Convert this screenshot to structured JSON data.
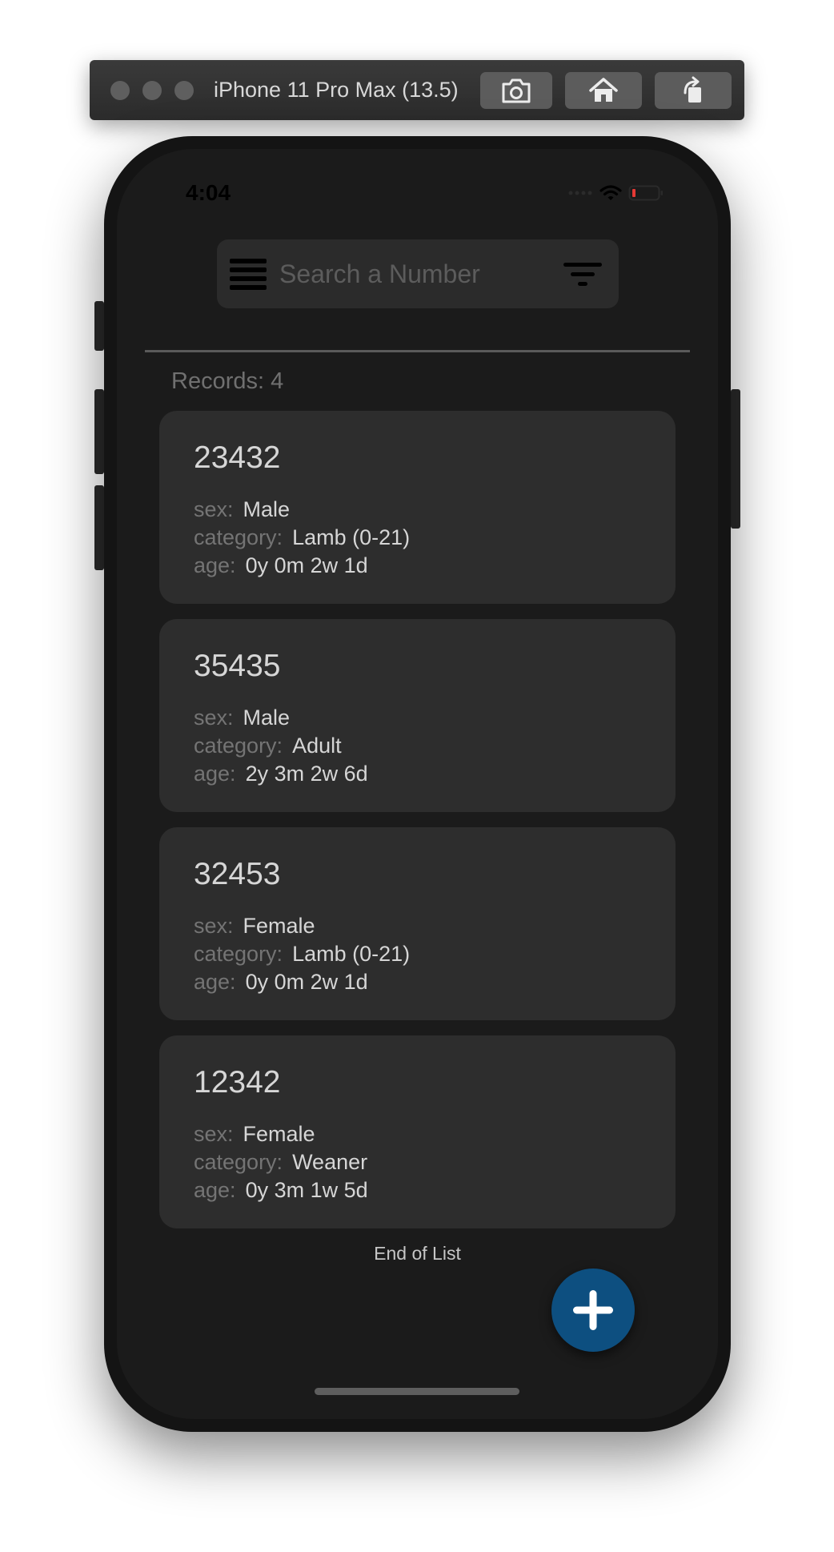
{
  "simulator": {
    "title": "iPhone 11 Pro Max (13.5)",
    "buttons": [
      "screenshot-icon",
      "home-icon",
      "rotate-icon"
    ]
  },
  "status_bar": {
    "time": "4:04",
    "icons": [
      "signal-icon",
      "wifi-icon",
      "battery-low-icon"
    ]
  },
  "search": {
    "placeholder": "Search a Number",
    "value": "",
    "menu_icon": "hamburger-menu-icon",
    "filter_icon": "filter-icon"
  },
  "records": {
    "label": "Records: 4"
  },
  "field_labels": {
    "sex": "sex:",
    "category": "category:",
    "age": "age:"
  },
  "items": [
    {
      "number": "23432",
      "sex": "Male",
      "category": "Lamb (0-21)",
      "age": "0y 0m 2w 1d"
    },
    {
      "number": "35435",
      "sex": "Male",
      "category": "Adult",
      "age": "2y 3m 2w 6d"
    },
    {
      "number": "32453",
      "sex": "Female",
      "category": "Lamb (0-21)",
      "age": "0y 0m 2w 1d"
    },
    {
      "number": "12342",
      "sex": "Female",
      "category": "Weaner",
      "age": "0y 3m 1w 5d"
    }
  ],
  "end_of_list": "End of List",
  "fab": {
    "icon": "plus-icon"
  },
  "colors": {
    "screen_bg": "#1b1b1b",
    "card_bg": "#2d2d2d",
    "fab_bg": "#0d4f80",
    "label_text": "#747474",
    "value_text": "#d6d6d6",
    "battery_low": "#e53935"
  }
}
